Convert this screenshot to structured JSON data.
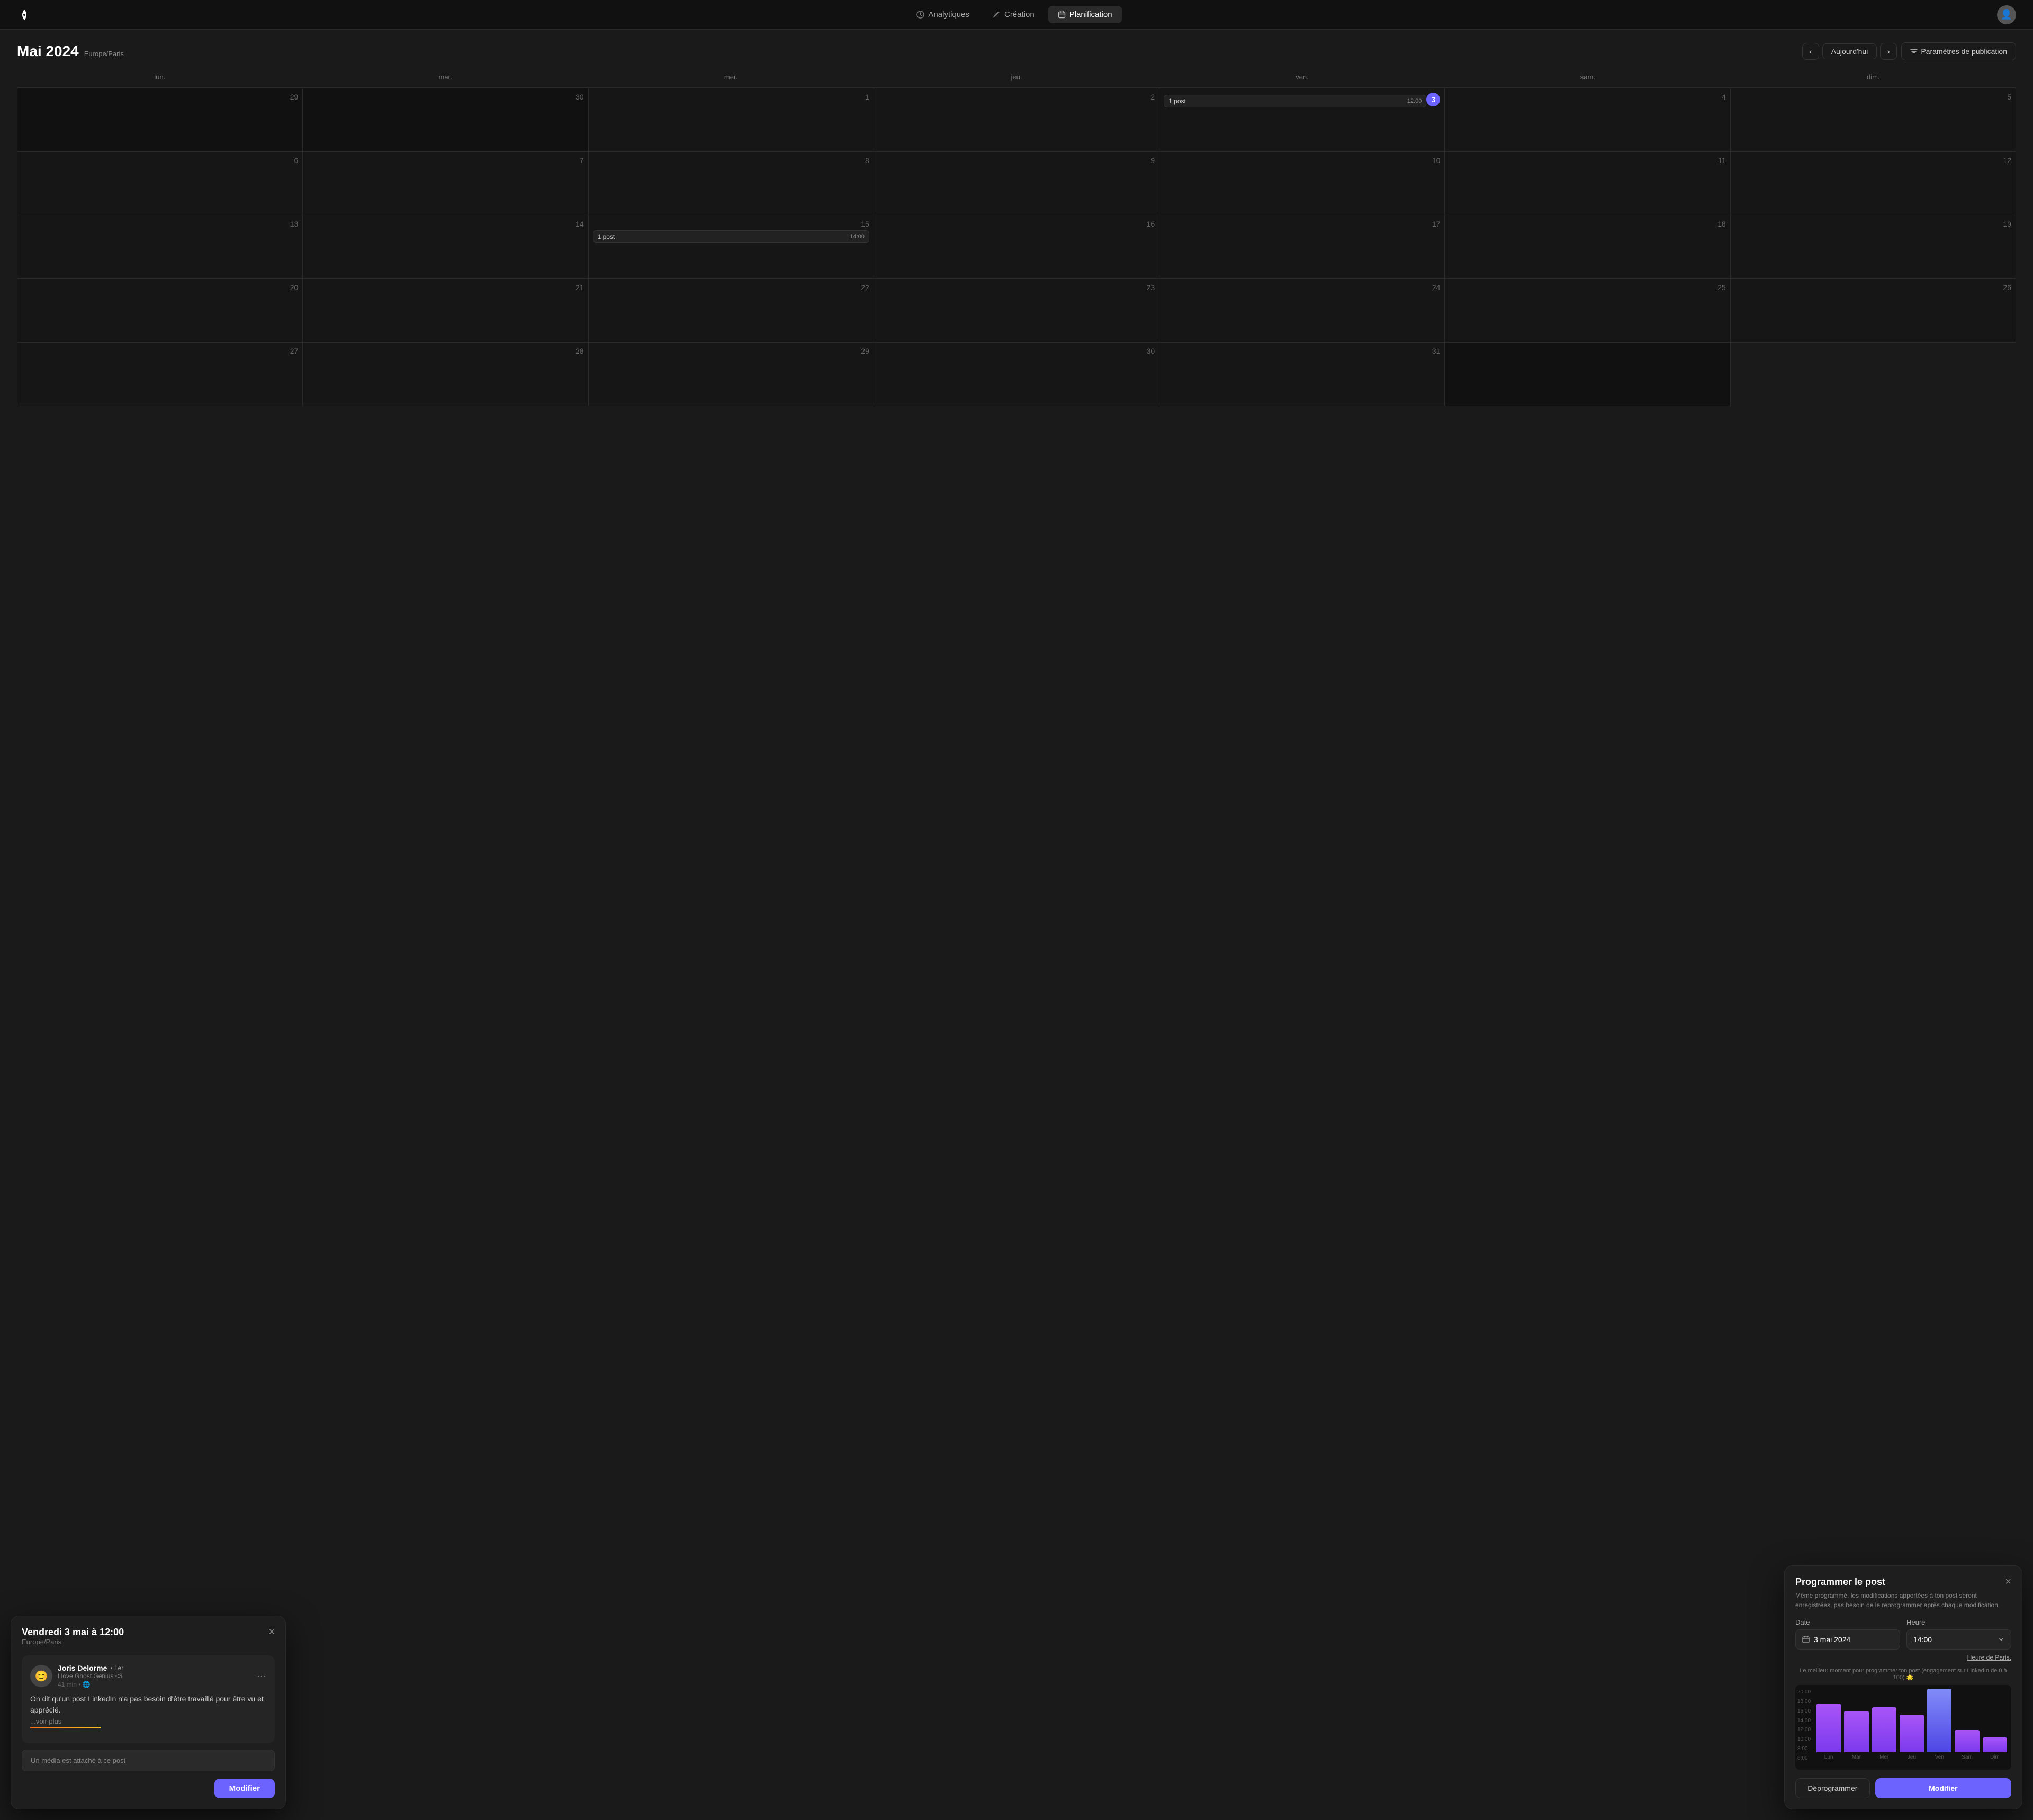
{
  "app": {
    "logo": "🐦"
  },
  "nav": {
    "items": [
      {
        "id": "analytiques",
        "label": "Analytiques",
        "icon": "clock",
        "active": false
      },
      {
        "id": "creation",
        "label": "Création",
        "icon": "pen",
        "active": false
      },
      {
        "id": "planification",
        "label": "Planification",
        "icon": "calendar",
        "active": true
      }
    ]
  },
  "calendar": {
    "title": "Mai 2024",
    "timezone": "Europe/Paris",
    "today_btn": "Aujourd'hui",
    "pub_btn": "Paramètres de publication",
    "day_names": [
      "lun.",
      "mar.",
      "mer.",
      "jeu.",
      "ven.",
      "sam.",
      "dim."
    ],
    "cells": [
      {
        "date": "29",
        "other": true,
        "events": []
      },
      {
        "date": "30",
        "other": true,
        "events": []
      },
      {
        "date": "1",
        "other": false,
        "events": []
      },
      {
        "date": "2",
        "other": false,
        "events": []
      },
      {
        "date": "3",
        "other": false,
        "today": true,
        "events": [
          {
            "label": "1 post",
            "time": "12:00"
          }
        ]
      },
      {
        "date": "4",
        "other": false,
        "events": []
      },
      {
        "date": "5",
        "other": false,
        "events": []
      },
      {
        "date": "6",
        "other": false,
        "events": []
      },
      {
        "date": "7",
        "other": false,
        "events": []
      },
      {
        "date": "8",
        "other": false,
        "events": []
      },
      {
        "date": "9",
        "other": false,
        "events": []
      },
      {
        "date": "10",
        "other": false,
        "events": []
      },
      {
        "date": "11",
        "other": false,
        "events": []
      },
      {
        "date": "12",
        "other": false,
        "events": []
      },
      {
        "date": "13",
        "other": false,
        "events": []
      },
      {
        "date": "14",
        "other": false,
        "events": []
      },
      {
        "date": "15",
        "other": false,
        "events": [
          {
            "label": "1 post",
            "time": "14:00"
          }
        ]
      },
      {
        "date": "16",
        "other": false,
        "events": []
      },
      {
        "date": "17",
        "other": false,
        "events": []
      },
      {
        "date": "18",
        "other": false,
        "events": []
      },
      {
        "date": "19",
        "other": false,
        "events": []
      },
      {
        "date": "20",
        "other": false,
        "events": []
      },
      {
        "date": "21",
        "other": false,
        "events": []
      },
      {
        "date": "22",
        "other": false,
        "events": []
      },
      {
        "date": "23",
        "other": false,
        "events": []
      },
      {
        "date": "24",
        "other": false,
        "events": []
      },
      {
        "date": "25",
        "other": false,
        "events": []
      },
      {
        "date": "26",
        "other": false,
        "events": []
      },
      {
        "date": "27",
        "other": false,
        "events": []
      },
      {
        "date": "28",
        "other": false,
        "events": []
      },
      {
        "date": "29",
        "other": false,
        "events": []
      },
      {
        "date": "30",
        "other": false,
        "events": []
      },
      {
        "date": "31",
        "other": false,
        "events": []
      },
      {
        "date": "",
        "other": true,
        "events": []
      }
    ]
  },
  "popup_post": {
    "title": "Vendredi 3 mai à 12:00",
    "timezone": "Europe/Paris",
    "author_name": "Joris Delorme",
    "author_badge": "• 1er",
    "author_bio": "I love Ghost Genius <3",
    "author_meta": "41 min • 🌐",
    "post_body": "On dit qu'un post LinkedIn n'a pas besoin d'être travaillé pour être vu et apprécié.",
    "see_more": "...voir plus",
    "media_label": "Un média est attaché à ce post",
    "modifier_btn": "Modifier",
    "close": "×"
  },
  "popup_schedule": {
    "title": "Programmer le post",
    "desc": "Même programmé, les modifications apportées à ton post seront enregistrées, pas besoin de le reprogrammer après chaque modification.",
    "date_label": "Date",
    "time_label": "Heure",
    "date_value": "3 mai 2024",
    "time_value": "14:00",
    "paris_link": "Heure de Paris.",
    "chart_hint": "Le meilleur moment pour programmer ton post (engagement sur LinkedIn de 0 à 100) 🌟",
    "y_labels": [
      "6:00",
      "8:00",
      "10:00",
      "12:00",
      "14:00",
      "16:00",
      "18:00",
      "20:00"
    ],
    "x_labels": [
      "Lun",
      "Mar",
      "Mer",
      "Jeu",
      "Ven",
      "Sam",
      "Dim"
    ],
    "bar_heights": [
      65,
      55,
      60,
      50,
      85,
      30,
      20
    ],
    "deprogrammer_btn": "Déprogrammer",
    "modifier_btn": "Modifier",
    "close": "×"
  }
}
